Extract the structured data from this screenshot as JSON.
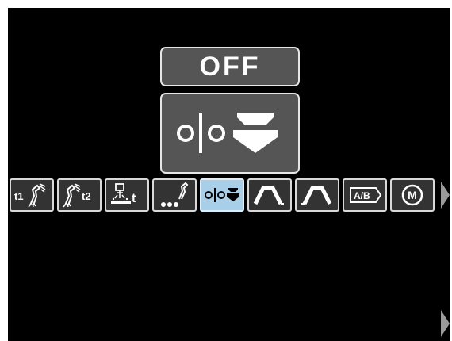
{
  "display": {
    "value": "OFF",
    "parameter_icon": "gas-preflow-purge-icon"
  },
  "menu": {
    "tiles": [
      {
        "icon": "t1-torch-preflow-icon",
        "text": "t1",
        "selected": false
      },
      {
        "icon": "torch-t2-postflow-icon",
        "text": "t2",
        "selected": false
      },
      {
        "icon": "spot-time-icon",
        "text": "t",
        "selected": false
      },
      {
        "icon": "restrike-torch-icon",
        "selected": false
      },
      {
        "icon": "gas-purge-icon",
        "selected": true
      },
      {
        "icon": "crater-start-ramp-icon",
        "selected": false
      },
      {
        "icon": "crater-end-ramp-icon",
        "selected": false
      },
      {
        "icon": "ab-procedure-icon",
        "text": "A/B",
        "selected": false
      },
      {
        "icon": "memory-icon",
        "text": "M",
        "selected": false
      }
    ]
  },
  "colors": {
    "screen": "#000000",
    "box": "#555555",
    "tile": "#333333",
    "selected_tile": "#a9cfe8",
    "border": "#e6e6e6"
  }
}
